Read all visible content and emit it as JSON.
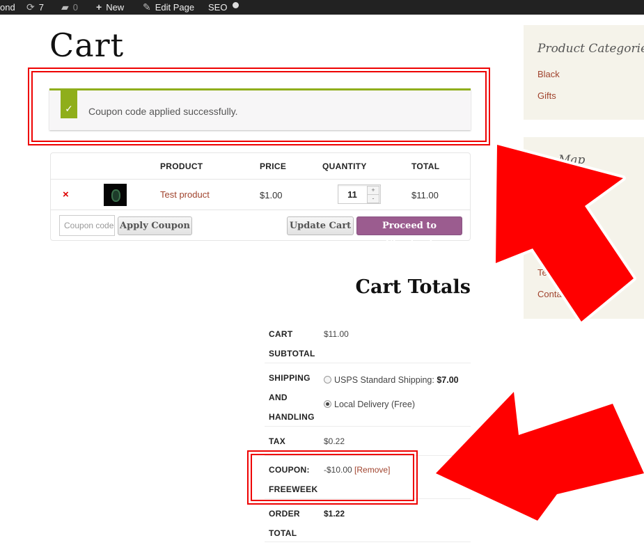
{
  "adminbar": {
    "site_fragment": "ond",
    "updates_count": "7",
    "comments_count": "0",
    "new_label": "New",
    "edit_page_label": "Edit Page",
    "seo_label": "SEO"
  },
  "page": {
    "title": "Cart"
  },
  "notice": {
    "text": "Coupon code applied successfully."
  },
  "cart_table": {
    "headers": {
      "product": "PRODUCT",
      "price": "PRICE",
      "quantity": "QUANTITY",
      "total": "TOTAL"
    },
    "row": {
      "product": "Test product",
      "price": "$1.00",
      "quantity": "11",
      "total": "$11.00"
    },
    "coupon_placeholder": "Coupon code",
    "apply_coupon_label": "Apply Coupon",
    "update_cart_label": "Update Cart",
    "checkout_label": "Proceed to Checkout"
  },
  "totals": {
    "title": "Cart Totals",
    "subtotal_label_1": "CART",
    "subtotal_label_2": "SUBTOTAL",
    "subtotal_value": "$11.00",
    "shipping_label_1": "SHIPPING",
    "shipping_label_2": "AND",
    "shipping_label_3": "HANDLING",
    "shipping_option_1": "USPS Standard Shipping:",
    "shipping_option_1_price": "$7.00",
    "shipping_option_2": "Local Delivery (Free)",
    "tax_label": "TAX",
    "tax_value": "$0.22",
    "coupon_label_1": "COUPON:",
    "coupon_label_2": "FREEWEEK",
    "coupon_value": "-$10.00",
    "coupon_remove": "[Remove]",
    "order_label_1": "ORDER",
    "order_label_2": "TOTAL",
    "order_value": "$1.22"
  },
  "sidebar": {
    "categories_title": "Product Categories",
    "categories": [
      "Black",
      "Gifts"
    ],
    "map_title_fragment": "Map",
    "link_fragment_1": "Te",
    "link_fragment_2": "Conta"
  },
  "colors": {
    "accent_green": "#8fae1b",
    "checkout_purple": "#9b5c8f",
    "link_brown": "#a0432d",
    "highlight_red": "#ee0000"
  }
}
